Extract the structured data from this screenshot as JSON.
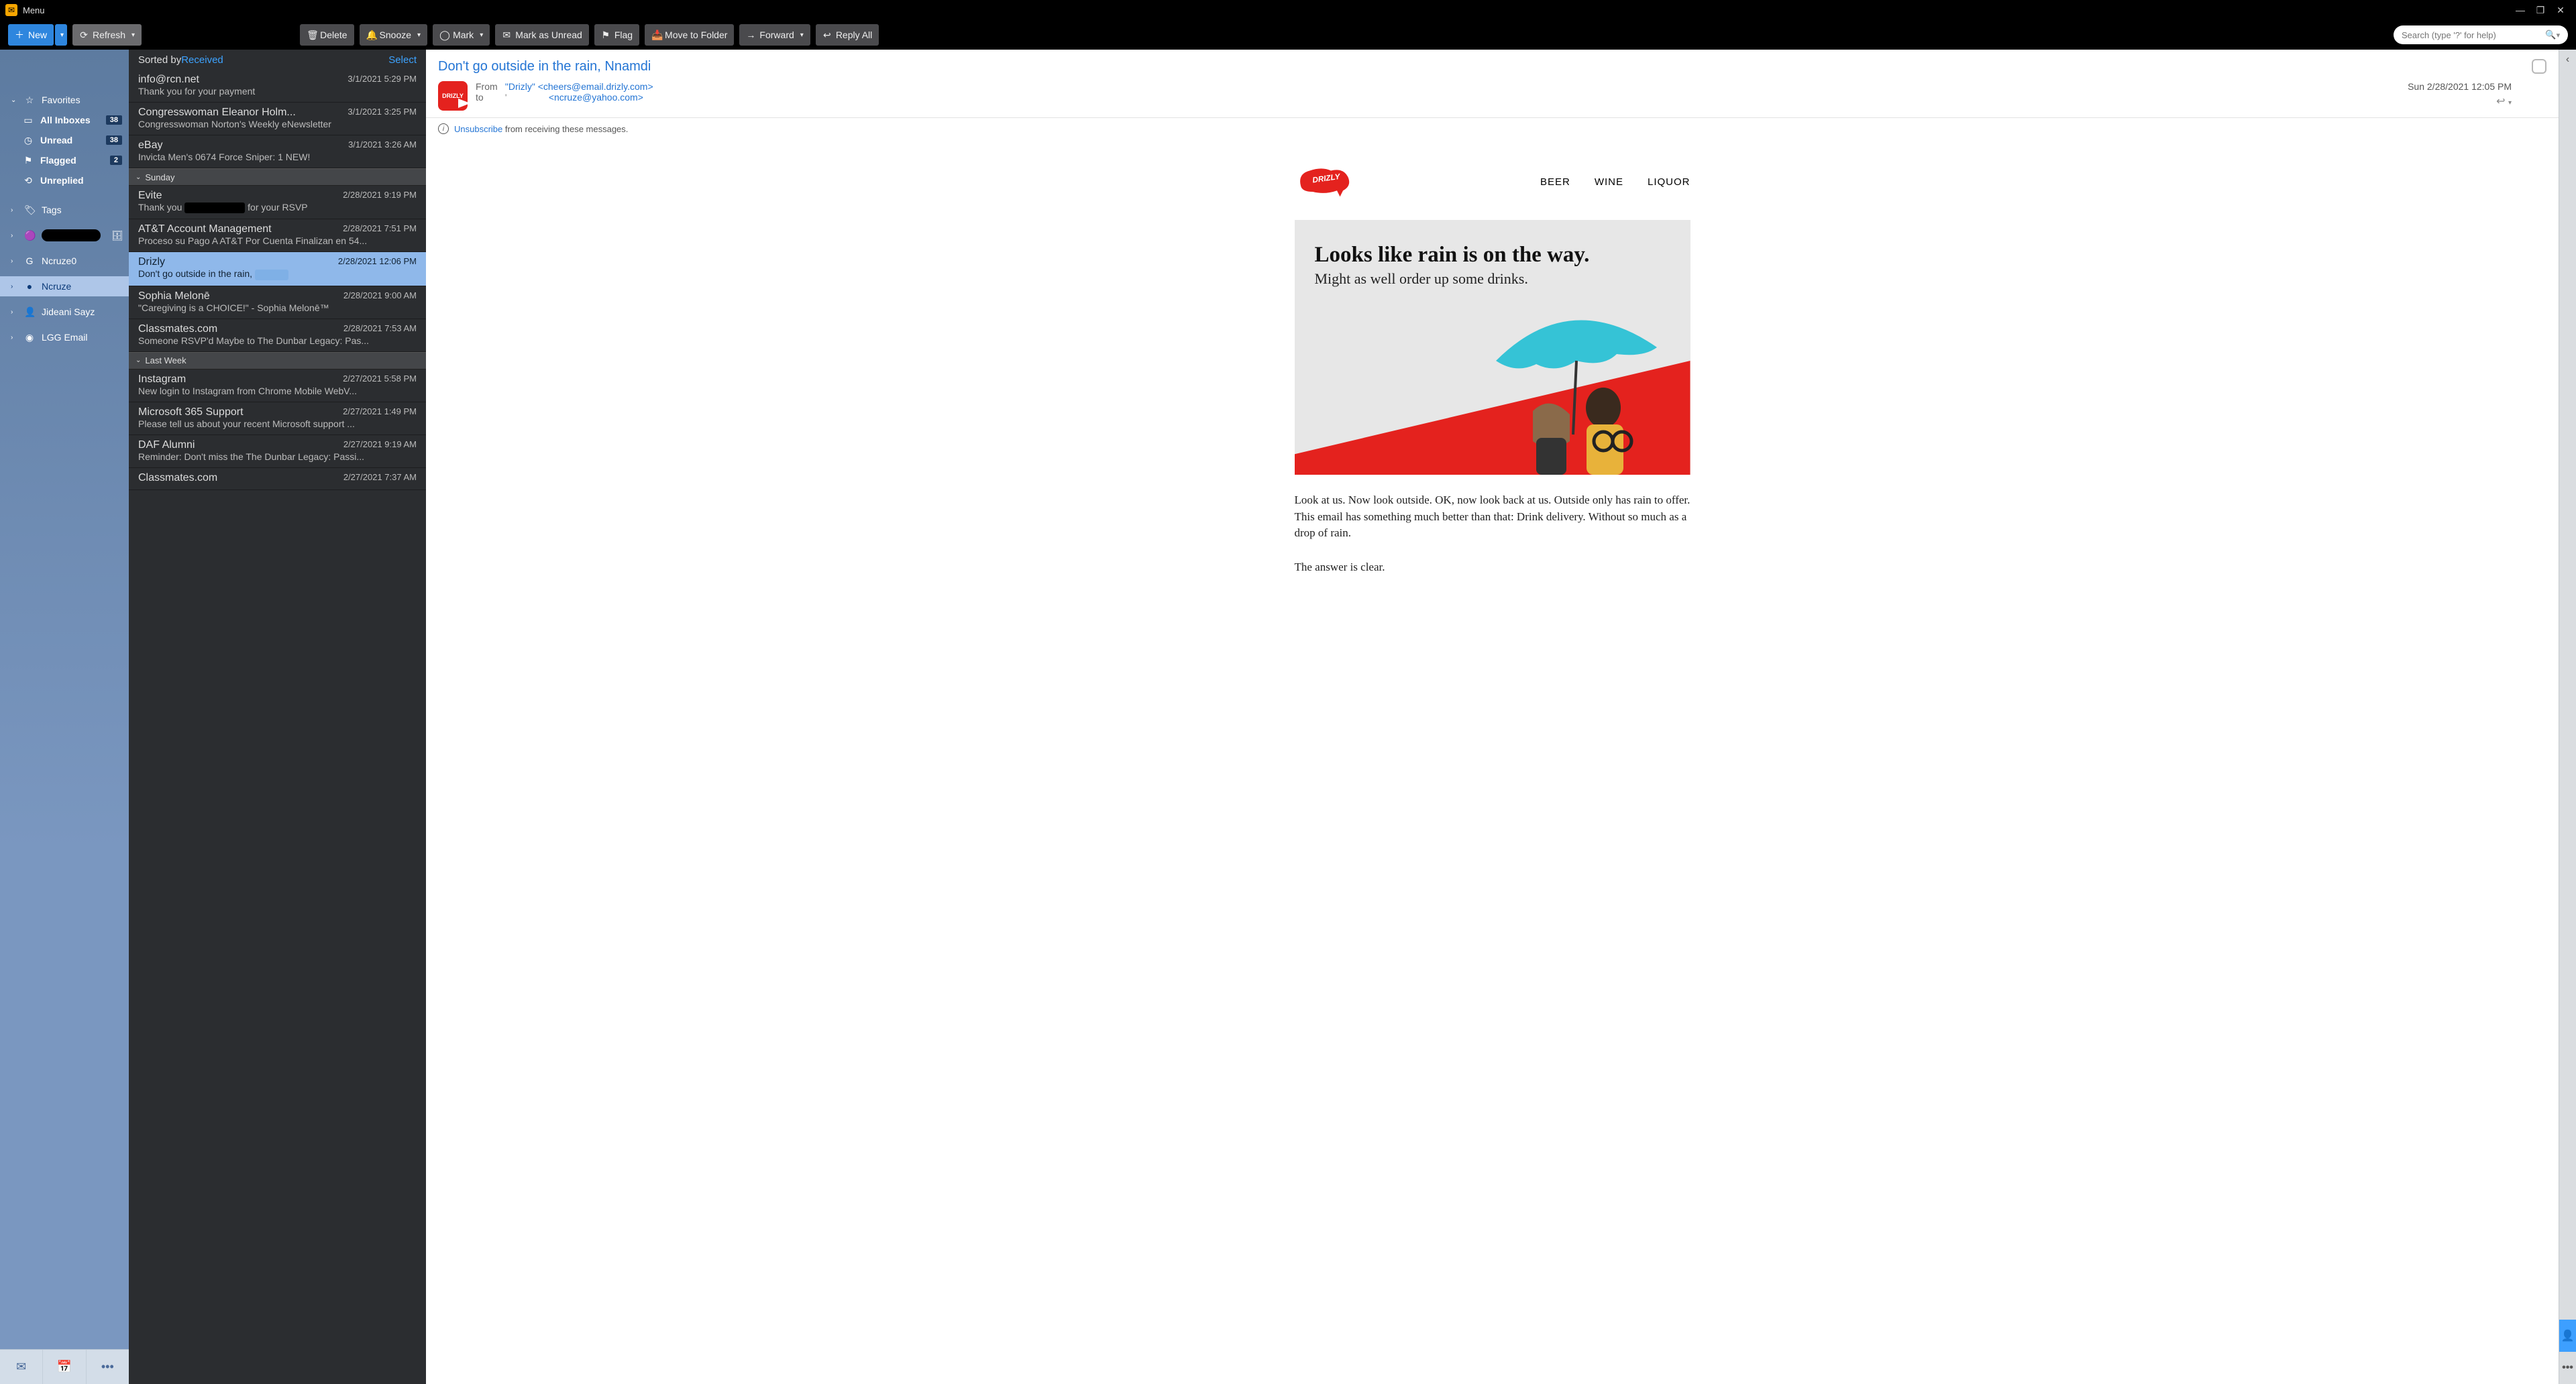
{
  "titlebar": {
    "menu": "Menu"
  },
  "toolbar": {
    "new": "New",
    "refresh": "Refresh",
    "delete": "Delete",
    "snooze": "Snooze",
    "mark": "Mark",
    "mark_unread": "Mark as Unread",
    "flag": "Flag",
    "move": "Move to Folder",
    "forward": "Forward",
    "reply_all": "Reply All",
    "search_placeholder": "Search (type '?' for help)"
  },
  "sidebar": {
    "favorites": "Favorites",
    "all_inboxes": {
      "label": "All Inboxes",
      "badge": "38"
    },
    "unread": {
      "label": "Unread",
      "badge": "38"
    },
    "flagged": {
      "label": "Flagged",
      "badge": "2"
    },
    "unreplied": {
      "label": "Unreplied"
    },
    "tags": "Tags",
    "accounts": [
      {
        "label": ""
      },
      {
        "label": "Ncruze0"
      },
      {
        "label": "Ncruze"
      },
      {
        "label": "Jideani Sayz"
      },
      {
        "label": "LGG Email"
      }
    ]
  },
  "list": {
    "sorted_by": "Sorted by ",
    "sort_field": "Received",
    "select": "Select",
    "groups": [
      {
        "items": [
          {
            "from": "info@rcn.net",
            "date": "3/1/2021 5:29 PM",
            "subj": "Thank you for your payment"
          },
          {
            "from": "Congresswoman Eleanor Holm...",
            "date": "3/1/2021 3:25 PM",
            "subj": "Congresswoman Norton's Weekly eNewsletter"
          },
          {
            "from": "eBay",
            "date": "3/1/2021 3:26 AM",
            "subj": "Invicta Men's 0674 Force Sniper: 1 NEW!"
          }
        ]
      },
      {
        "label": "Sunday",
        "items": [
          {
            "from": "Evite",
            "date": "2/28/2021 9:19 PM",
            "subj_pre": "Thank you ",
            "subj_post": " for your RSVP",
            "redact": true
          },
          {
            "from": "AT&T Account Management",
            "date": "2/28/2021 7:51 PM",
            "subj": "Proceso su Pago A AT&T Por Cuenta Finalizan en 54..."
          },
          {
            "from": "Drizly",
            "date": "2/28/2021 12:06 PM",
            "subj": "Don't go outside in the rain, ",
            "selected": true,
            "redact2": true
          },
          {
            "from": "Sophia Melonē",
            "date": "2/28/2021 9:00 AM",
            "subj": "\"Caregiving is a CHOICE!\" - Sophia Melonē™"
          },
          {
            "from": "Classmates.com",
            "date": "2/28/2021 7:53 AM",
            "subj": "Someone RSVP'd Maybe to The Dunbar Legacy: Pas..."
          }
        ]
      },
      {
        "label": "Last Week",
        "items": [
          {
            "from": "Instagram",
            "date": "2/27/2021 5:58 PM",
            "subj": "New login to Instagram from Chrome Mobile WebV..."
          },
          {
            "from": "Microsoft 365 Support",
            "date": "2/27/2021 1:49 PM",
            "subj": "Please tell us about your recent Microsoft support ..."
          },
          {
            "from": "DAF Alumni",
            "date": "2/27/2021 9:19 AM",
            "subj": "Reminder: Don't miss the The Dunbar Legacy: Passi..."
          },
          {
            "from": "Classmates.com",
            "date": "2/27/2021 7:37 AM",
            "subj": ""
          }
        ]
      }
    ]
  },
  "reader": {
    "subject": "Don't go outside in the rain, Nnamdi",
    "from_label": "From",
    "to_label": "to",
    "from_name": "\"Drizly\"",
    "from_addr": "<cheers@email.drizly.com>",
    "to_addr": "<ncruze@yahoo.com>",
    "date": "Sun 2/28/2021 12:05 PM",
    "unsubscribe": "Unsubscribe",
    "unsubscribe_tail": " from receiving these messages.",
    "nav": [
      "BEER",
      "WINE",
      "LIQUOR"
    ],
    "hero_h1": "Looks like rain is on the way.",
    "hero_h2": "Might as well order up some drinks.",
    "para1": "Look at us. Now look outside. OK, now look back at us. Outside only has rain to offer. This email has something much better than that: Drink delivery. Without so much as a drop of rain.",
    "para2": "The answer is clear."
  }
}
